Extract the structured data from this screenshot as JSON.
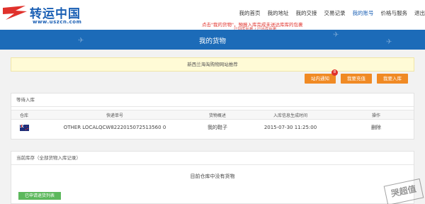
{
  "brand": {
    "name": "转运中国",
    "url": "www.uszcn.com"
  },
  "nav": {
    "items": [
      {
        "label": "我的首页"
      },
      {
        "label": "我的地址"
      },
      {
        "label": "我的交接"
      },
      {
        "label": "交易记录"
      },
      {
        "label": "我的账号"
      },
      {
        "label": "价格与服务"
      },
      {
        "label": "退出"
      }
    ]
  },
  "notice": {
    "main": "点击\"我的货物\"，預报入库完成未送达库库的包裹",
    "sub": "已到库包裹 / 已出库包裹"
  },
  "page": {
    "title": "我的货物"
  },
  "info_bar": {
    "text": "新西兰海淘购物网站推荐"
  },
  "actions": {
    "notify_label": "站内通知",
    "notify_badge": "8",
    "recharge_label": "我要充值",
    "inbound_label": "我要入库"
  },
  "pending": {
    "title": "等待入库",
    "columns": [
      "仓库",
      "快递单号",
      "货物概述",
      "入库信息生成时间",
      "操作"
    ],
    "rows": [
      {
        "warehouse": "NZ",
        "tracking": "OTHER LOCALQCW8222015072513560 0",
        "description": "我的鞋子",
        "created": "2015-07-30 11:25:00",
        "action": "删除"
      }
    ]
  },
  "inventory": {
    "title": "当前库存（全部货物入库记录）",
    "empty": "目前仓库中没有货物",
    "button": "已申请退货列表"
  },
  "watermark": "哭超值",
  "colors": {
    "brand_blue": "#1a5fb4",
    "banner_blue": "#1c6bb8",
    "action_orange": "#f08a24",
    "notice_red": "#e0312b",
    "success_green": "#5cb85c"
  }
}
